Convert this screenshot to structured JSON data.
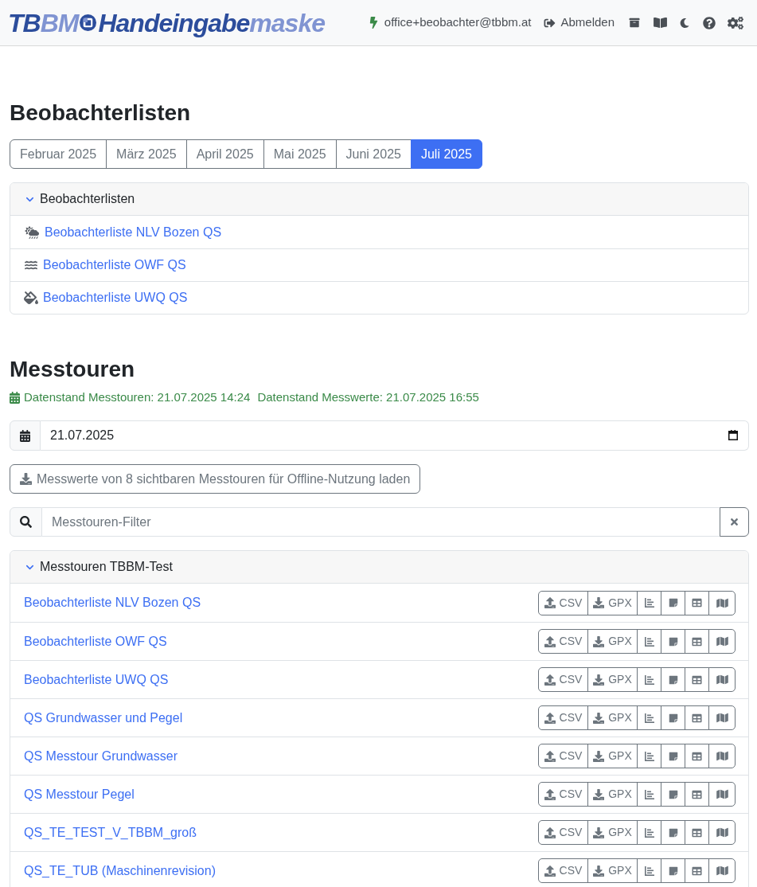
{
  "navbar": {
    "logo_before_mark": [
      {
        "text": "TB",
        "color": "#2c4d9c"
      },
      {
        "text": "BM",
        "color": "#8094d2"
      }
    ],
    "logo_after_mark": [
      {
        "text": "Handeingabe",
        "color": "#2c4d9c"
      },
      {
        "text": "maske",
        "color": "#8094d2"
      }
    ],
    "user": "office+beobachter@tbbm.at",
    "logout": "Abmelden"
  },
  "observer_lists": {
    "heading": "Beobachterlisten",
    "months": [
      {
        "label": "Februar 2025",
        "selected": false
      },
      {
        "label": "März 2025",
        "selected": false
      },
      {
        "label": "April 2025",
        "selected": false
      },
      {
        "label": "Mai 2025",
        "selected": false
      },
      {
        "label": "Juni 2025",
        "selected": false
      },
      {
        "label": "Juli 2025",
        "selected": true
      }
    ],
    "panel": {
      "title": "Beobachterlisten",
      "expanded": true,
      "items": [
        "Beobachterliste NLV Bozen QS",
        "Beobachterliste OWF QS",
        "Beobachterliste UWQ QS"
      ]
    }
  },
  "tours": {
    "heading": "Messtouren",
    "status": [
      "Datenstand Messtouren: 21.07.2025 14:24",
      "Datenstand Messwerte: 21.07.2025 16:55"
    ],
    "date": {
      "value": "21.07.2025"
    },
    "offline_button": "Messwerte von 8 sichtbaren Messtouren für Offline-Nutzung laden",
    "filter": {
      "placeholder": "Messtouren-Filter"
    },
    "panel": {
      "title": "Messtouren TBBM-Test",
      "expanded": true,
      "rows": [
        {
          "name": "Beobachterliste NLV Bozen QS",
          "csv": "CSV",
          "gpx": "GPX"
        },
        {
          "name": "Beobachterliste OWF QS",
          "csv": "CSV",
          "gpx": "GPX"
        },
        {
          "name": "Beobachterliste UWQ QS",
          "csv": "CSV",
          "gpx": "GPX"
        },
        {
          "name": "QS Grundwasser und Pegel",
          "csv": "CSV",
          "gpx": "GPX"
        },
        {
          "name": "QS Messtour Grundwasser",
          "csv": "CSV",
          "gpx": "GPX"
        },
        {
          "name": "QS Messtour Pegel",
          "csv": "CSV",
          "gpx": "GPX"
        },
        {
          "name": "QS_TE_TEST_V_TBBM_groß",
          "csv": "CSV",
          "gpx": "GPX"
        },
        {
          "name": "QS_TE_TUB (Maschinenrevision)",
          "csv": "CSV",
          "gpx": "GPX"
        }
      ]
    }
  }
}
